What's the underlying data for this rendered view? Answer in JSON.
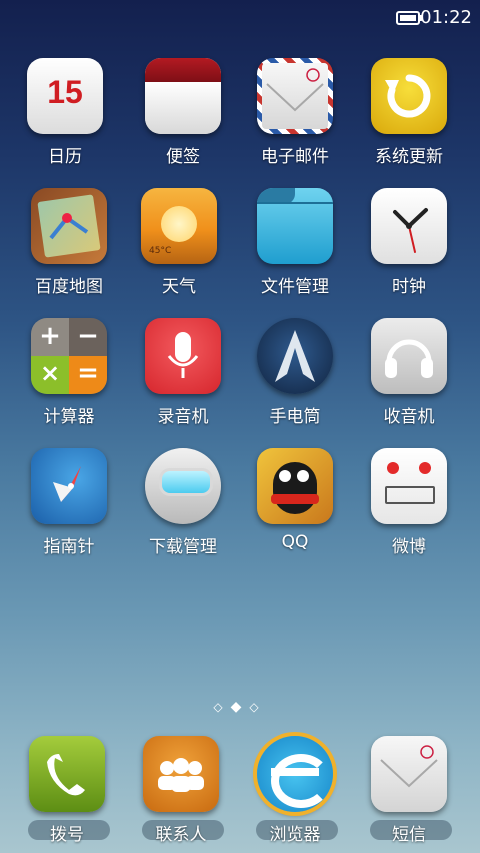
{
  "status": {
    "time": "01:22",
    "battery": "battery-icon"
  },
  "apps": [
    {
      "label": "日历",
      "icon": "calendar-icon",
      "badge": "15"
    },
    {
      "label": "便签",
      "icon": "notes-icon"
    },
    {
      "label": "电子邮件",
      "icon": "email-icon"
    },
    {
      "label": "系统更新",
      "icon": "update-icon"
    },
    {
      "label": "百度地图",
      "icon": "map-icon"
    },
    {
      "label": "天气",
      "icon": "weather-icon",
      "sub": "45°C"
    },
    {
      "label": "文件管理",
      "icon": "folder-icon"
    },
    {
      "label": "时钟",
      "icon": "clock-icon"
    },
    {
      "label": "计算器",
      "icon": "calculator-icon"
    },
    {
      "label": "录音机",
      "icon": "microphone-icon"
    },
    {
      "label": "手电筒",
      "icon": "flashlight-icon"
    },
    {
      "label": "收音机",
      "icon": "headphones-icon"
    },
    {
      "label": "指南针",
      "icon": "compass-icon"
    },
    {
      "label": "下载管理",
      "icon": "download-robot-icon"
    },
    {
      "label": "QQ",
      "icon": "qq-penguin-icon"
    },
    {
      "label": "微博",
      "icon": "weibo-robot-icon"
    }
  ],
  "pager": {
    "pages": 3,
    "current": 2
  },
  "dock": [
    {
      "label": "拨号",
      "icon": "phone-icon"
    },
    {
      "label": "联系人",
      "icon": "contacts-icon"
    },
    {
      "label": "浏览器",
      "icon": "browser-icon"
    },
    {
      "label": "短信",
      "icon": "sms-icon"
    }
  ]
}
